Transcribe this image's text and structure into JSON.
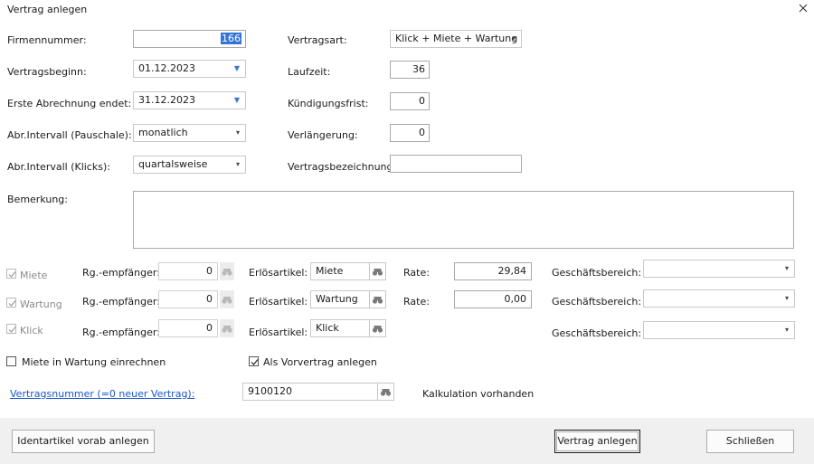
{
  "window": {
    "title": "Vertrag anlegen",
    "close_icon": "close-icon"
  },
  "left": {
    "firmennummer": {
      "label": "Firmennummer:",
      "value": "166"
    },
    "vertragsbeginn": {
      "label": "Vertragsbeginn:",
      "value": "01.12.2023"
    },
    "erste_abrechnung": {
      "label": "Erste Abrechnung endet:",
      "value": "31.12.2023"
    },
    "intervall_pauschale": {
      "label": "Abr.Intervall (Pauschale):",
      "value": "monatlich"
    },
    "intervall_klicks": {
      "label": "Abr.Intervall (Klicks):",
      "value": "quartalsweise"
    }
  },
  "right": {
    "vertragsart": {
      "label": "Vertragsart:",
      "value": "Klick + Miete + Wartung"
    },
    "laufzeit": {
      "label": "Laufzeit:",
      "value": "36"
    },
    "kuendigungsfrist": {
      "label": "Kündigungsfrist:",
      "value": "0"
    },
    "verlaengerung": {
      "label": "Verlängerung:",
      "value": "0"
    },
    "vertragsbezeichnung": {
      "label": "Vertragsbezeichnung:",
      "value": ""
    }
  },
  "bemerkung": {
    "label": "Bemerkung:",
    "value": ""
  },
  "rows": [
    {
      "check_label": "Miete",
      "checked": true,
      "rg_label": "Rg.-empfänger:",
      "rg_value": "0",
      "erl_label": "Erlösartikel:",
      "erl_value": "Miete",
      "rate_label": "Rate:",
      "rate_value": "29,84",
      "gb_label": "Geschäftsbereich:",
      "gb_value": ""
    },
    {
      "check_label": "Wartung",
      "checked": true,
      "rg_label": "Rg.-empfänger:",
      "rg_value": "0",
      "erl_label": "Erlösartikel:",
      "erl_value": "Wartung",
      "rate_label": "Rate:",
      "rate_value": "0,00",
      "gb_label": "Geschäftsbereich:",
      "gb_value": ""
    },
    {
      "check_label": "Klick",
      "checked": true,
      "rg_label": "Rg.-empfänger:",
      "rg_value": "0",
      "erl_label": "Erlösartikel:",
      "erl_value": "Klick",
      "gb_label": "Geschäftsbereich:",
      "gb_value": ""
    }
  ],
  "options": {
    "miete_in_wartung": {
      "label": "Miete in Wartung einrechnen",
      "checked": false
    },
    "als_vorvertrag": {
      "label": "Als Vorvertrag anlegen",
      "checked": true
    }
  },
  "vertragsnummer": {
    "link_label": "Vertragsnummer (=0 neuer Vertrag):",
    "value": "9100120",
    "status": "Kalkulation vorhanden"
  },
  "buttons": {
    "identartikel": "Identartikel vorab anlegen",
    "vertrag_anlegen": "Vertrag anlegen",
    "schliessen": "Schließen"
  },
  "colors": {
    "link": "#1a55cc",
    "selection": "#3375d6",
    "footer": "#f0f0f0"
  }
}
